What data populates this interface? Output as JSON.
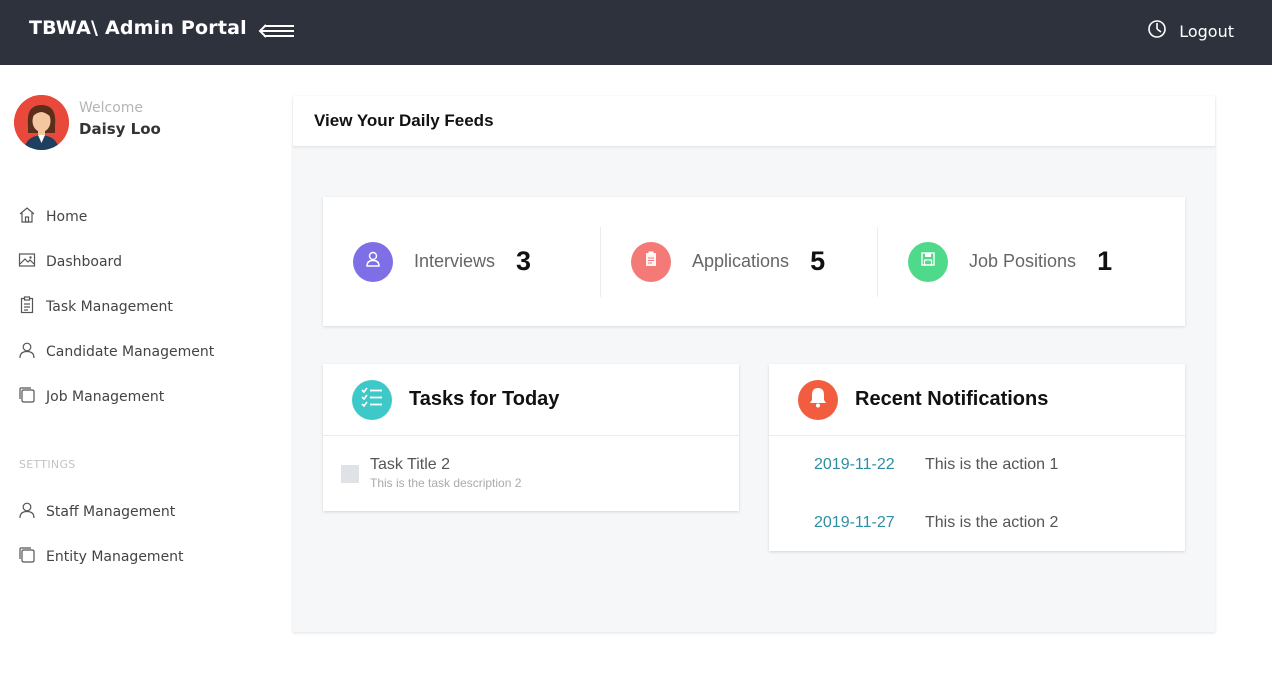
{
  "header": {
    "brand": "TBWA\\ Admin Portal",
    "logout_label": "Logout"
  },
  "user": {
    "welcome": "Welcome",
    "name": "Daisy Loo"
  },
  "sidebar": {
    "items": [
      {
        "label": "Home",
        "icon": "home-icon"
      },
      {
        "label": "Dashboard",
        "icon": "image-icon"
      },
      {
        "label": "Task Management",
        "icon": "clipboard-icon"
      },
      {
        "label": "Candidate Management",
        "icon": "user-icon"
      },
      {
        "label": "Job Management",
        "icon": "stack-icon"
      }
    ],
    "settings_label": "SETTINGS",
    "settings_items": [
      {
        "label": "Staff Management",
        "icon": "user-icon"
      },
      {
        "label": "Entity Management",
        "icon": "stack-icon"
      }
    ]
  },
  "main": {
    "title": "View Your Daily Feeds",
    "stats": [
      {
        "label": "Interviews",
        "value": "3",
        "color": "#7e6fe6",
        "icon": "user-icon"
      },
      {
        "label": "Applications",
        "value": "5",
        "color": "#f47a78",
        "icon": "document-icon"
      },
      {
        "label": "Job Positions",
        "value": "1",
        "color": "#4fd98b",
        "icon": "floppy-icon"
      }
    ],
    "tasks": {
      "title": "Tasks for Today",
      "color": "#3ec8c8",
      "items": [
        {
          "title": "Task Title 2",
          "description": "This is the task description 2"
        }
      ]
    },
    "notifications": {
      "title": "Recent Notifications",
      "color": "#f25d3f",
      "items": [
        {
          "date": "2019-11-22",
          "text": "This is the action 1"
        },
        {
          "date": "2019-11-27",
          "text": "This is the action 2"
        }
      ]
    }
  }
}
